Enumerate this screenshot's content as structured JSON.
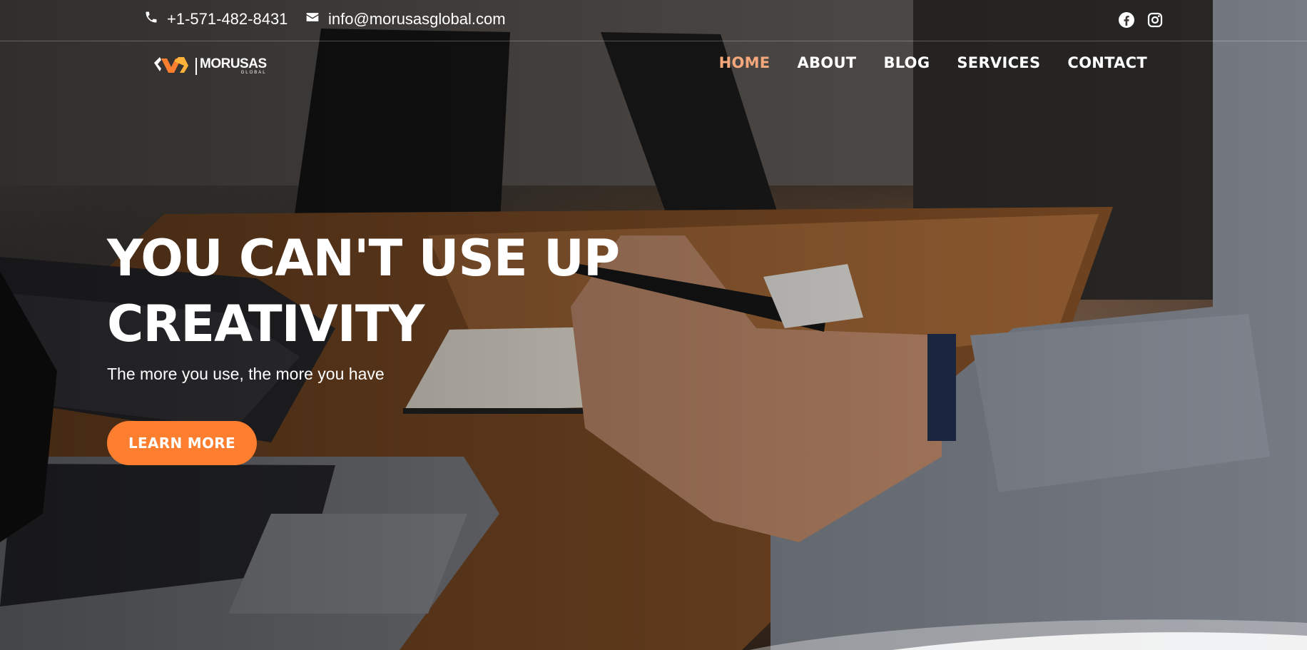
{
  "topbar": {
    "phone": "+1-571-482-8431",
    "email": "info@morusasglobal.com",
    "phone_icon": "phone-icon",
    "email_icon": "envelope-icon",
    "social": [
      "facebook-icon",
      "instagram-icon"
    ]
  },
  "logo": {
    "name": "MORUSAS",
    "sub": "GLOBAL"
  },
  "nav": {
    "items": [
      "HOME",
      "ABOUT",
      "BLOG",
      "SERVICES",
      "CONTACT"
    ],
    "active": "HOME"
  },
  "hero": {
    "headline_line1": "YOU CAN'T USE UP",
    "headline_line2": "CREATIVITY",
    "subtitle": "The more you use, the more you have",
    "cta": "LEARN MORE"
  },
  "colors": {
    "accent": "#fd7e2e",
    "nav_active": "#f5a87c",
    "text": "#ffffff"
  }
}
